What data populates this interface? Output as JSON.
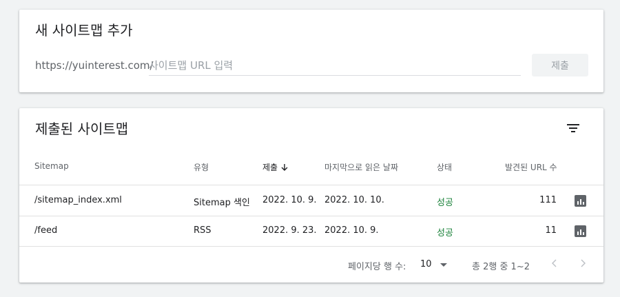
{
  "add_sitemap": {
    "title": "새 사이트맵 추가",
    "url_prefix": "https://yuinterest.com/",
    "input_placeholder": "사이트맵 URL 입력",
    "input_value": "",
    "submit_label": "제출"
  },
  "submitted": {
    "title": "제출된 사이트맵",
    "filter_icon": "filter-icon",
    "columns": {
      "sitemap": "Sitemap",
      "type": "유형",
      "submitted": "제출",
      "last_read": "마지막으로 읽은 날짜",
      "status": "상태",
      "discovered": "발견된 URL 수"
    },
    "sort_icon": "arrow-down-icon",
    "rows": [
      {
        "sitemap": "/sitemap_index.xml",
        "type": "Sitemap 색인",
        "submitted": "2022. 10. 9.",
        "last_read": "2022. 10. 10.",
        "status": "성공",
        "discovered": "111"
      },
      {
        "sitemap": "/feed",
        "type": "RSS",
        "submitted": "2022. 9. 23.",
        "last_read": "2022. 10. 9.",
        "status": "성공",
        "discovered": "11"
      }
    ],
    "footer": {
      "rows_per_page_label": "페이지당 행 수:",
      "rows_per_page_value": "10",
      "range": "총 2행 중 1~2"
    }
  },
  "colors": {
    "background": "#f1f3f4",
    "status_success": "#188038",
    "text_secondary": "#5f6368"
  }
}
